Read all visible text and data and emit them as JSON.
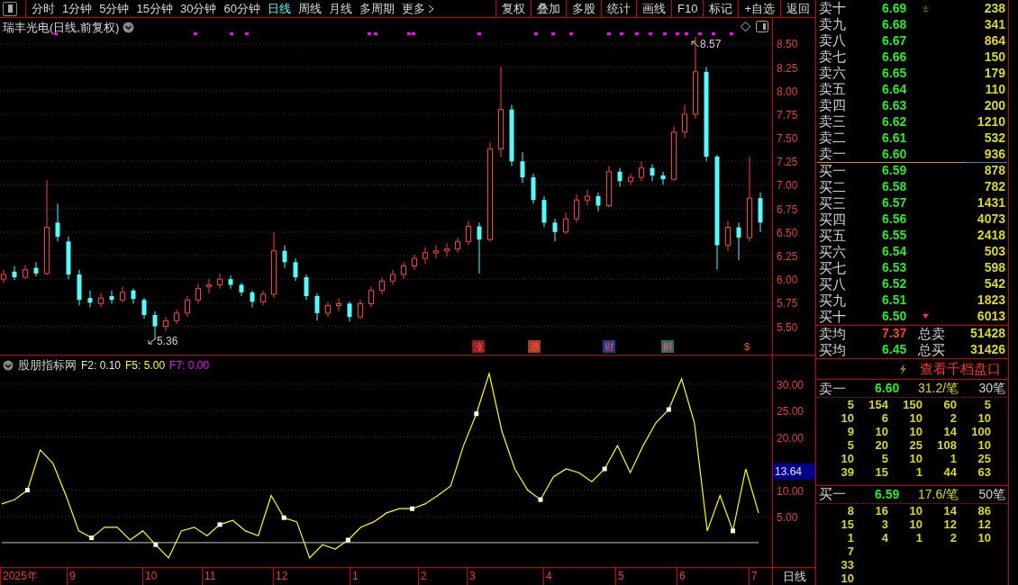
{
  "toolbar": {
    "period_tabs": [
      {
        "label": "分时",
        "selected": false
      },
      {
        "label": "1分钟",
        "selected": false
      },
      {
        "label": "5分钟",
        "selected": false
      },
      {
        "label": "15分钟",
        "selected": false
      },
      {
        "label": "30分钟",
        "selected": false
      },
      {
        "label": "60分钟",
        "selected": false
      },
      {
        "label": "日线",
        "selected": true
      },
      {
        "label": "周线",
        "selected": false
      },
      {
        "label": "月线",
        "selected": false
      },
      {
        "label": "多周期",
        "selected": false
      },
      {
        "label": "更多",
        "selected": false
      }
    ],
    "buttons": [
      "复权",
      "叠加",
      "多股",
      "统计",
      "画线",
      "F10",
      "标记",
      "+自选",
      "返回"
    ]
  },
  "price_chart": {
    "title": "瑞丰光电(日线,前复权)",
    "high_label": "8.57",
    "low_label": "5.36",
    "chart_data": {
      "type": "candlestick",
      "grid": true,
      "ylim": [
        5.19,
        8.58
      ],
      "yticks": [
        {
          "value": 8.5,
          "label": "8.50"
        },
        {
          "value": 8.25,
          "label": "8.25"
        },
        {
          "value": 8,
          "label": "8.00"
        },
        {
          "value": 7.75,
          "label": "7.75"
        },
        {
          "value": 7.5,
          "label": "7.50"
        },
        {
          "value": 7.25,
          "label": "7.25"
        },
        {
          "value": 7,
          "label": "7.00"
        },
        {
          "value": 6.75,
          "label": "6.75"
        },
        {
          "value": 6.5,
          "label": "6.50"
        },
        {
          "value": 6.25,
          "label": "6.25"
        },
        {
          "value": 6,
          "label": "6.00"
        },
        {
          "value": 5.75,
          "label": "5.75"
        },
        {
          "value": 5.5,
          "label": "5.50"
        }
      ],
      "ohlc": [
        [
          6.0,
          6.1,
          5.96,
          6.05
        ],
        [
          6.08,
          6.14,
          5.99,
          6.02
        ],
        [
          6.02,
          6.15,
          6.0,
          6.1
        ],
        [
          6.12,
          6.18,
          6.03,
          6.06
        ],
        [
          6.06,
          7.05,
          6.04,
          6.55
        ],
        [
          6.6,
          6.8,
          6.4,
          6.45
        ],
        [
          6.4,
          6.45,
          6.0,
          6.05
        ],
        [
          6.05,
          6.1,
          5.72,
          5.78
        ],
        [
          5.8,
          5.88,
          5.7,
          5.75
        ],
        [
          5.74,
          5.85,
          5.7,
          5.8
        ],
        [
          5.82,
          5.88,
          5.74,
          5.78
        ],
        [
          5.78,
          5.92,
          5.75,
          5.86
        ],
        [
          5.88,
          5.9,
          5.74,
          5.79
        ],
        [
          5.78,
          5.8,
          5.58,
          5.62
        ],
        [
          5.62,
          5.66,
          5.36,
          5.5
        ],
        [
          5.5,
          5.6,
          5.45,
          5.56
        ],
        [
          5.56,
          5.68,
          5.52,
          5.64
        ],
        [
          5.64,
          5.82,
          5.6,
          5.78
        ],
        [
          5.78,
          5.95,
          5.74,
          5.9
        ],
        [
          5.92,
          6.0,
          5.85,
          5.94
        ],
        [
          5.94,
          6.06,
          5.9,
          6.0
        ],
        [
          6.0,
          6.04,
          5.9,
          5.94
        ],
        [
          5.94,
          5.96,
          5.82,
          5.86
        ],
        [
          5.86,
          5.88,
          5.7,
          5.76
        ],
        [
          5.76,
          5.88,
          5.72,
          5.84
        ],
        [
          5.84,
          6.5,
          5.8,
          6.3
        ],
        [
          6.3,
          6.36,
          6.12,
          6.18
        ],
        [
          6.18,
          6.22,
          5.98,
          6.02
        ],
        [
          6.02,
          6.05,
          5.78,
          5.82
        ],
        [
          5.82,
          5.85,
          5.56,
          5.64
        ],
        [
          5.64,
          5.76,
          5.6,
          5.72
        ],
        [
          5.72,
          5.8,
          5.66,
          5.74
        ],
        [
          5.74,
          5.76,
          5.55,
          5.6
        ],
        [
          5.6,
          5.78,
          5.58,
          5.74
        ],
        [
          5.74,
          5.92,
          5.7,
          5.88
        ],
        [
          5.88,
          6.02,
          5.84,
          5.98
        ],
        [
          5.98,
          6.1,
          5.94,
          6.05
        ],
        [
          6.05,
          6.18,
          6.0,
          6.14
        ],
        [
          6.14,
          6.26,
          6.1,
          6.22
        ],
        [
          6.22,
          6.34,
          6.16,
          6.28
        ],
        [
          6.28,
          6.36,
          6.22,
          6.3
        ],
        [
          6.3,
          6.38,
          6.24,
          6.32
        ],
        [
          6.32,
          6.44,
          6.28,
          6.4
        ],
        [
          6.4,
          6.62,
          6.36,
          6.56
        ],
        [
          6.56,
          6.6,
          6.06,
          6.42
        ],
        [
          6.42,
          7.45,
          6.4,
          7.38
        ],
        [
          7.38,
          8.25,
          7.3,
          7.8
        ],
        [
          7.8,
          7.85,
          7.2,
          7.25
        ],
        [
          7.25,
          7.35,
          7.02,
          7.08
        ],
        [
          7.08,
          7.12,
          6.8,
          6.84
        ],
        [
          6.84,
          6.88,
          6.55,
          6.6
        ],
        [
          6.6,
          6.64,
          6.4,
          6.5
        ],
        [
          6.5,
          6.7,
          6.48,
          6.64
        ],
        [
          6.64,
          6.9,
          6.6,
          6.84
        ],
        [
          6.84,
          6.95,
          6.78,
          6.88
        ],
        [
          6.88,
          6.92,
          6.72,
          6.78
        ],
        [
          6.78,
          7.2,
          6.76,
          7.14
        ],
        [
          7.14,
          7.18,
          6.98,
          7.04
        ],
        [
          7.04,
          7.12,
          7.0,
          7.08
        ],
        [
          7.08,
          7.25,
          7.04,
          7.18
        ],
        [
          7.18,
          7.22,
          7.04,
          7.1
        ],
        [
          7.1,
          7.14,
          7.0,
          7.06
        ],
        [
          7.06,
          7.62,
          7.04,
          7.56
        ],
        [
          7.56,
          7.85,
          7.5,
          7.75
        ],
        [
          7.75,
          8.57,
          7.7,
          8.2
        ],
        [
          8.2,
          8.25,
          7.25,
          7.3
        ],
        [
          7.3,
          7.32,
          6.1,
          6.36
        ],
        [
          6.36,
          6.62,
          6.3,
          6.55
        ],
        [
          6.55,
          6.6,
          6.2,
          6.44
        ],
        [
          6.44,
          7.3,
          6.4,
          6.86
        ],
        [
          6.86,
          6.92,
          6.5,
          6.6
        ]
      ]
    },
    "events": [
      {
        "label": "涨",
        "color": "#8c1c1c"
      },
      {
        "label": "激",
        "color": "#a0401c"
      },
      {
        "label": "财",
        "color": "#1c3c8c"
      },
      {
        "label": "解",
        "color": "#1c7070"
      },
      {
        "label": "$",
        "color": "#000000"
      }
    ]
  },
  "indicator": {
    "legend": [
      {
        "text": "股朋指标网",
        "color": "#c8c8c8"
      },
      {
        "text": "F2: 0.10",
        "color": "#e6e6e6"
      },
      {
        "text": "F5: 5.00",
        "color": "#ffff00"
      },
      {
        "text": "F7: 0.00",
        "color": "#ff00ff"
      }
    ],
    "cursor_value": "13.64",
    "chart_data": {
      "type": "line",
      "grid": true,
      "ylim": [
        -4.5,
        35.4
      ],
      "yticks": [
        {
          "value": 30,
          "label": "30.00"
        },
        {
          "value": 25,
          "label": "25.00"
        },
        {
          "value": 20,
          "label": "20.00"
        },
        {
          "value": 10,
          "label": "10.00"
        },
        {
          "value": 5,
          "label": "5.00"
        }
      ],
      "series": [
        {
          "color": "#ffff00",
          "values": [
            7.4,
            8.2,
            10,
            17.6,
            15,
            9,
            2.3,
            1,
            3,
            3,
            0.6,
            2.3,
            -0.3,
            -2.8,
            2.3,
            3,
            1.4,
            3.5,
            4.3,
            2.3,
            1.4,
            9,
            4.8,
            4,
            -2.8,
            -0.3,
            -1.1,
            0.6,
            3,
            4,
            5.7,
            6.5,
            6.5,
            7.4,
            9,
            10.8,
            18.4,
            24.4,
            32,
            21,
            14,
            10,
            8.2,
            12.5,
            14,
            13.3,
            11.6,
            14,
            18.4,
            13.3,
            18.4,
            22.7,
            25.2,
            31,
            22.7,
            2.3,
            9,
            2.3,
            14,
            5.7
          ]
        }
      ]
    }
  },
  "date_axis": {
    "labels": [
      "2025年",
      "9",
      "10",
      "11",
      "12",
      "1",
      "2",
      "3",
      "4",
      "5",
      "6",
      "7"
    ],
    "period": "日线"
  },
  "order_book": {
    "asks": [
      {
        "label": "卖十",
        "price": "6.69",
        "volume": "238"
      },
      {
        "label": "卖九",
        "price": "6.68",
        "volume": "341"
      },
      {
        "label": "卖八",
        "price": "6.67",
        "volume": "864"
      },
      {
        "label": "卖七",
        "price": "6.66",
        "volume": "150"
      },
      {
        "label": "卖六",
        "price": "6.65",
        "volume": "179"
      },
      {
        "label": "卖五",
        "price": "6.64",
        "volume": "110"
      },
      {
        "label": "卖四",
        "price": "6.63",
        "volume": "200"
      },
      {
        "label": "卖三",
        "price": "6.62",
        "volume": "1210"
      },
      {
        "label": "卖二",
        "price": "6.61",
        "volume": "532"
      },
      {
        "label": "卖一",
        "price": "6.60",
        "volume": "936"
      }
    ],
    "bids": [
      {
        "label": "买一",
        "price": "6.59",
        "volume": "878"
      },
      {
        "label": "买二",
        "price": "6.58",
        "volume": "782"
      },
      {
        "label": "买三",
        "price": "6.57",
        "volume": "1431"
      },
      {
        "label": "买四",
        "price": "6.56",
        "volume": "4073"
      },
      {
        "label": "买五",
        "price": "6.55",
        "volume": "2418"
      },
      {
        "label": "买六",
        "price": "6.54",
        "volume": "503"
      },
      {
        "label": "买七",
        "price": "6.53",
        "volume": "598"
      },
      {
        "label": "买八",
        "price": "6.52",
        "volume": "542"
      },
      {
        "label": "买九",
        "price": "6.51",
        "volume": "1823"
      },
      {
        "label": "买十",
        "price": "6.50",
        "volume": "6013"
      }
    ],
    "averages": [
      {
        "label": "卖均",
        "price": "7.37",
        "color": "#ff3c3c",
        "total_label": "总卖",
        "total": "51428"
      },
      {
        "label": "买均",
        "price": "6.45",
        "color": "#2ee62e",
        "total_label": "总买",
        "total": "31426"
      }
    ]
  },
  "depth_link": "查看千档盘口",
  "queues": [
    {
      "label": "卖一",
      "price": "6.60",
      "avg": "31.2/笔",
      "count": "30笔",
      "rows": [
        [
          "5",
          "154",
          "150",
          "60",
          "5"
        ],
        [
          "10",
          "6",
          "10",
          "2",
          "10"
        ],
        [
          "9",
          "10",
          "10",
          "14",
          "100"
        ],
        [
          "5",
          "20",
          "25",
          "108",
          "10"
        ],
        [
          "10",
          "5",
          "10",
          "1",
          "25"
        ],
        [
          "39",
          "15",
          "1",
          "44",
          "63"
        ]
      ]
    },
    {
      "label": "买一",
      "price": "6.59",
      "avg": "17.6/笔",
      "count": "50笔",
      "rows": [
        [
          "8",
          "16",
          "10",
          "14",
          "86"
        ],
        [
          "15",
          "3",
          "10",
          "12",
          "12"
        ],
        [
          "1",
          "4",
          "1",
          "2",
          "10"
        ],
        [
          "7"
        ],
        [
          "33"
        ],
        [
          "10"
        ]
      ]
    }
  ]
}
